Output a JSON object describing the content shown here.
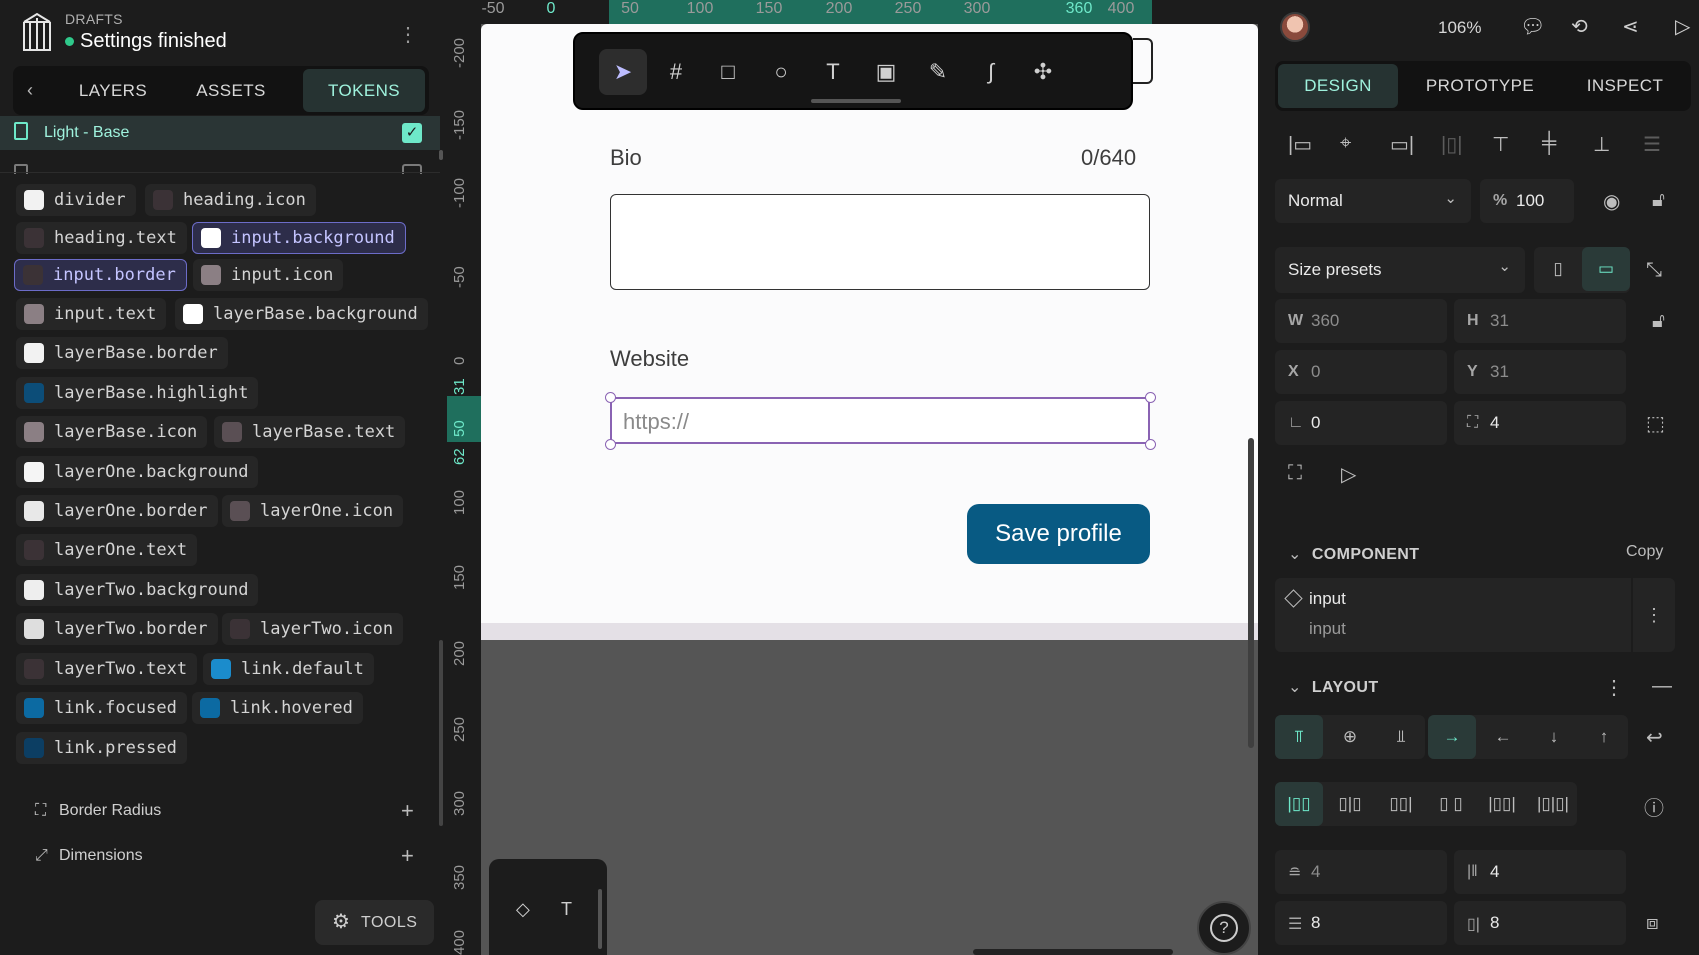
{
  "project": {
    "label": "DRAFTS",
    "title": "Settings finished",
    "status_color": "#2fc98b"
  },
  "left_tabs": [
    "LAYERS",
    "ASSETS",
    "TOKENS"
  ],
  "active_left_tab": "TOKENS",
  "token_set": {
    "name": "Light - Base",
    "checked": true
  },
  "tokens": [
    {
      "name": "divider",
      "color": "#f2f2f2"
    },
    {
      "name": "heading.icon",
      "color": "#3b3236"
    },
    {
      "name": "heading.text",
      "color": "#3b3236"
    },
    {
      "name": "input.background",
      "color": "#ffffff",
      "selected": true
    },
    {
      "name": "input.border",
      "color": "#3b3236",
      "selected": true
    },
    {
      "name": "input.icon",
      "color": "#8b7f84"
    },
    {
      "name": "input.text",
      "color": "#8b7f84"
    },
    {
      "name": "layerBase.background",
      "color": "#ffffff"
    },
    {
      "name": "layerBase.border",
      "color": "#f2f2f2"
    },
    {
      "name": "layerBase.highlight",
      "color": "#0c4d78"
    },
    {
      "name": "layerBase.icon",
      "color": "#8b7f84"
    },
    {
      "name": "layerBase.text",
      "color": "#5a4f54"
    },
    {
      "name": "layerOne.background",
      "color": "#f5f5f5"
    },
    {
      "name": "layerOne.border",
      "color": "#e8e8e8"
    },
    {
      "name": "layerOne.icon",
      "color": "#5a4f54"
    },
    {
      "name": "layerOne.text",
      "color": "#3b3236"
    },
    {
      "name": "layerTwo.background",
      "color": "#eeeeee"
    },
    {
      "name": "layerTwo.border",
      "color": "#dedede"
    },
    {
      "name": "layerTwo.icon",
      "color": "#3b3236"
    },
    {
      "name": "layerTwo.text",
      "color": "#3b3236"
    },
    {
      "name": "link.default",
      "color": "#1b8ccc"
    },
    {
      "name": "link.focused",
      "color": "#0c6aa2"
    },
    {
      "name": "link.hovered",
      "color": "#0c6aa2"
    },
    {
      "name": "link.pressed",
      "color": "#0c3e63"
    }
  ],
  "sections": [
    {
      "name": "Border Radius",
      "icon": "border-radius-icon"
    },
    {
      "name": "Dimensions",
      "icon": "dimensions-icon"
    }
  ],
  "tools_label": "TOOLS",
  "ruler": {
    "h_labels": [
      "-50",
      "0",
      "50",
      "100",
      "150",
      "200",
      "250",
      "300",
      "360",
      "400"
    ],
    "v_labels": [
      "-200",
      "-150",
      "-100",
      "-50",
      "0",
      "31",
      "50",
      "62",
      "100",
      "150",
      "200",
      "250",
      "300",
      "350",
      "400"
    ]
  },
  "canvas": {
    "bio_label": "Bio",
    "bio_count": "0/640",
    "website_label": "Website",
    "website_placeholder": "https://",
    "save_button": "Save profile",
    "save_color": "#085a83"
  },
  "toolbar": [
    "pointer-icon",
    "board-icon",
    "rectangle-icon",
    "ellipse-icon",
    "text-icon",
    "image-icon",
    "pen-icon",
    "path-icon",
    "plugin-icon"
  ],
  "zoom": "106%",
  "right_tabs": [
    "DESIGN",
    "PROTOTYPE",
    "INSPECT"
  ],
  "active_right_tab": "DESIGN",
  "layer": {
    "blend": "Normal",
    "opacity_prefix": "%",
    "opacity": "100",
    "size_preset": "Size presets",
    "w_label": "W",
    "w": "360",
    "h_label": "H",
    "h": "31",
    "x_label": "X",
    "x": "0",
    "y_label": "Y",
    "y": "31",
    "rotation": "0",
    "radius": "4"
  },
  "component": {
    "title": "COMPONENT",
    "copy": "Copy",
    "name": "input",
    "path": "input"
  },
  "layout": {
    "title": "LAYOUT",
    "row_gap": "4",
    "col_gap": "4",
    "padding_v": "8",
    "padding_h": "8"
  }
}
